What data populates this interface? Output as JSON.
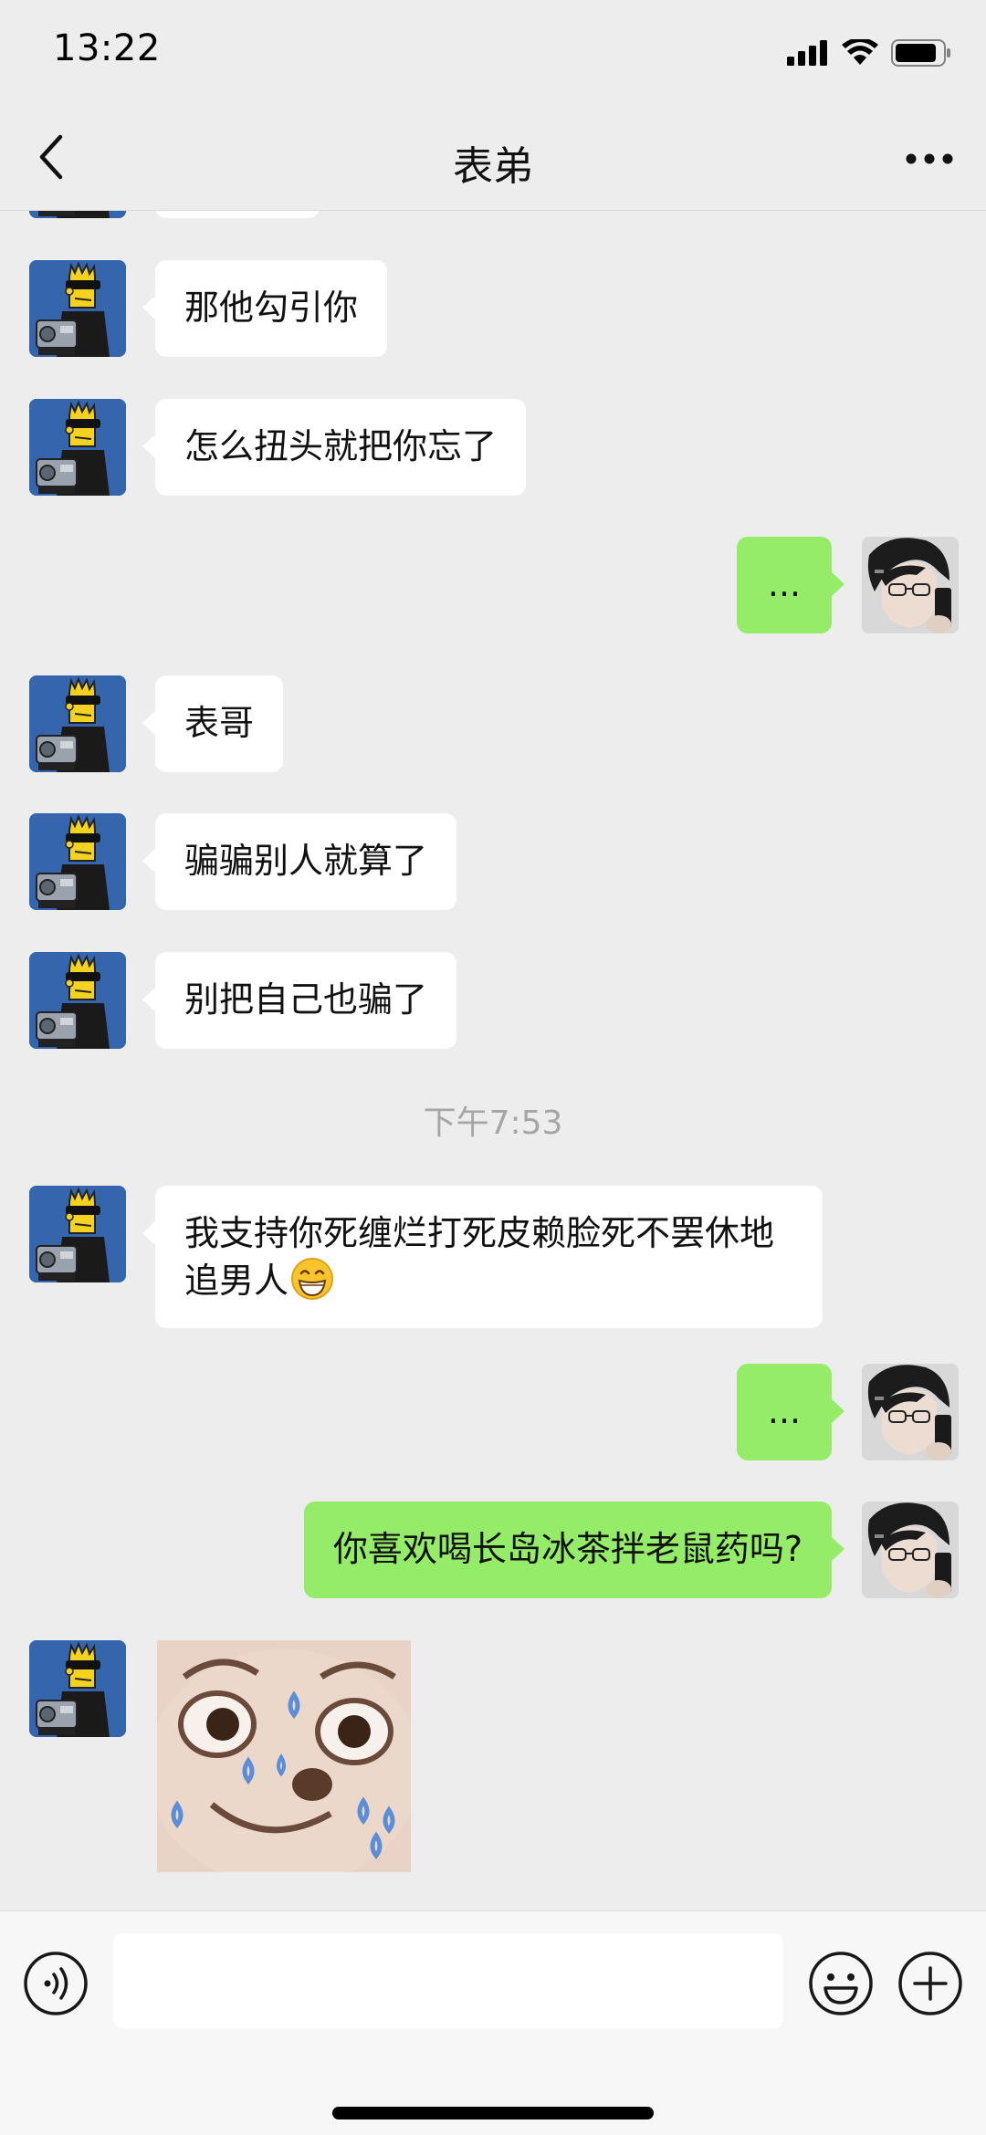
{
  "status_bar": {
    "time": "13:22"
  },
  "nav": {
    "title": "表弟",
    "back_icon": "chevron-left-icon",
    "more_icon": "ellipsis-icon"
  },
  "messages": [
    {
      "side": "in",
      "text": "那他勾引你"
    },
    {
      "side": "in",
      "text": "怎么扭头就把你忘了"
    },
    {
      "side": "out",
      "text": "..."
    },
    {
      "side": "in",
      "text": "表哥"
    },
    {
      "side": "in",
      "text": "骗骗别人就算了"
    },
    {
      "side": "in",
      "text": "别把自己也骗了"
    },
    {
      "type": "time",
      "text": "下午7:53"
    },
    {
      "side": "in",
      "text_line1": "我支持你死缠烂打死皮赖脸死不罢休地",
      "text_line2": "追男人",
      "emoji": "grin-emoji"
    },
    {
      "side": "out",
      "text": "..."
    },
    {
      "side": "out",
      "text": "你喜欢喝长岛冰茶拌老鼠药吗?"
    },
    {
      "side": "in",
      "type": "sticker",
      "sticker": "sweating-face-sticker"
    }
  ],
  "input_bar": {
    "value": "",
    "voice_icon": "voice-icon",
    "emoji_icon": "emoji-icon",
    "plus_icon": "plus-icon"
  },
  "colors": {
    "background": "#ededed",
    "outgoing_bubble": "#95ec69",
    "incoming_bubble": "#ffffff",
    "timestamp": "#a6a6a6"
  }
}
